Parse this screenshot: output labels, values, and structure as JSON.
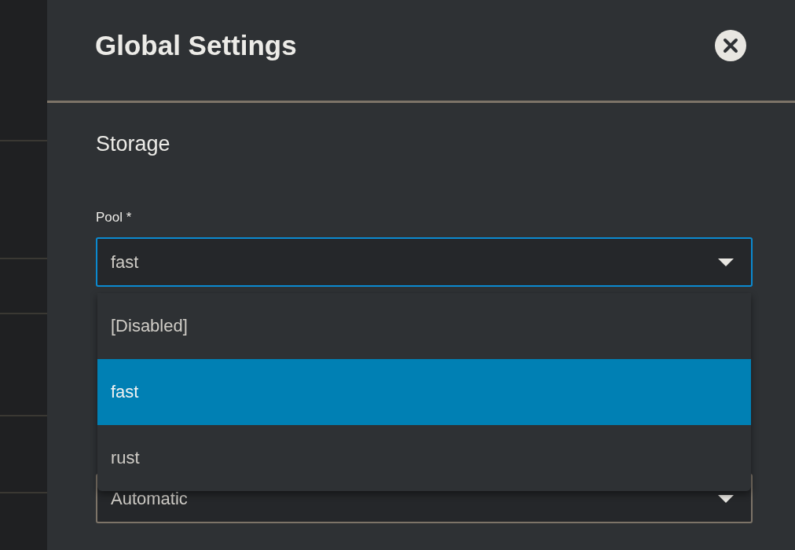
{
  "dialog": {
    "title": "Global Settings"
  },
  "section": {
    "title": "Storage"
  },
  "fields": [
    {
      "label": "Pool *",
      "value": "fast",
      "focused": true,
      "options": [
        {
          "label": "[Disabled]",
          "selected": false
        },
        {
          "label": "fast",
          "selected": true
        },
        {
          "label": "rust",
          "selected": false
        }
      ]
    },
    {
      "value": "Automatic",
      "focused": false
    }
  ]
}
